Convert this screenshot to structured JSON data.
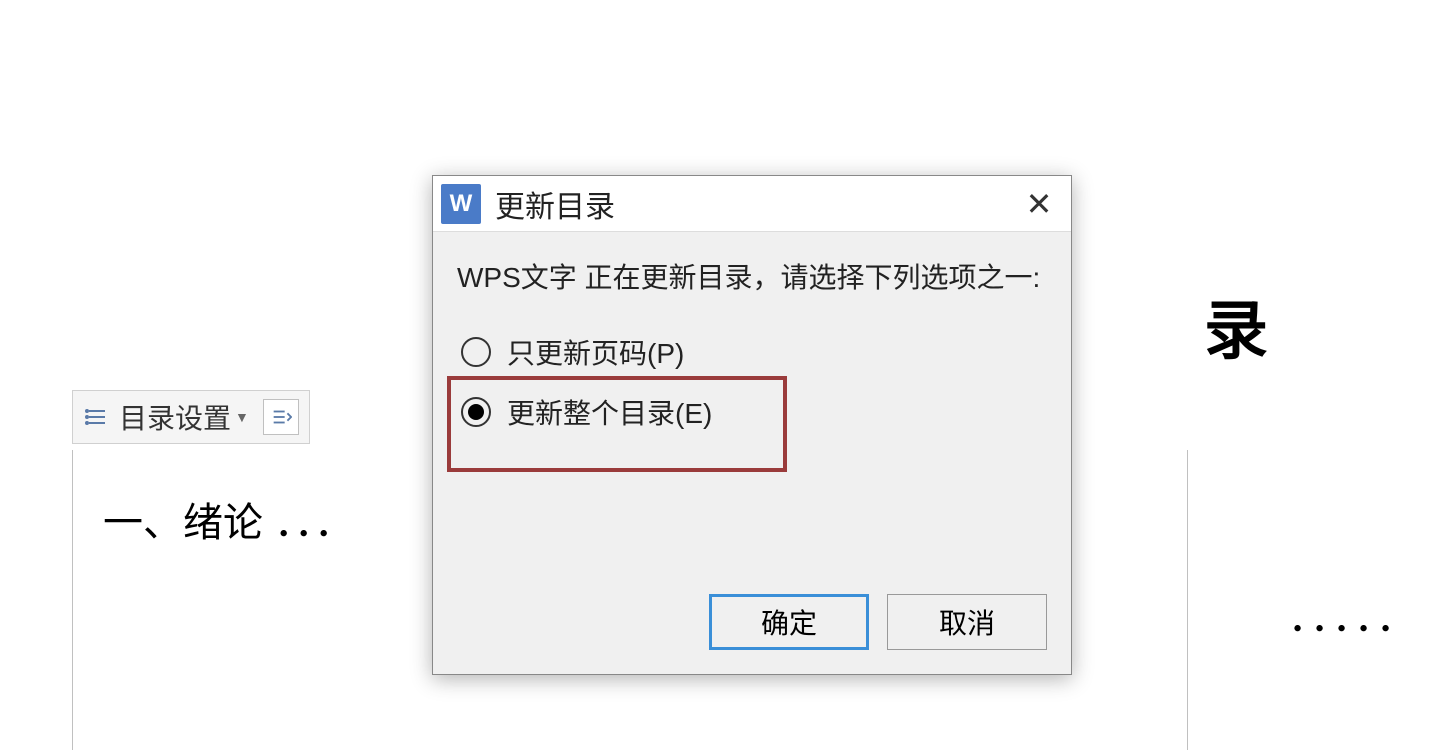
{
  "document": {
    "toolbar_settings_label": "目录设置",
    "toc_line1": "一、绪论 ．．．",
    "bg_title_fragment": "录",
    "bg_dots": "．．．．．"
  },
  "dialog": {
    "app_icon_letter": "W",
    "title": "更新目录",
    "message": "WPS文字 正在更新目录，请选择下列选项之一:",
    "radios": {
      "pages_only": "只更新页码(P)",
      "entire": "更新整个目录(E)"
    },
    "buttons": {
      "ok": "确定",
      "cancel": "取消"
    }
  }
}
